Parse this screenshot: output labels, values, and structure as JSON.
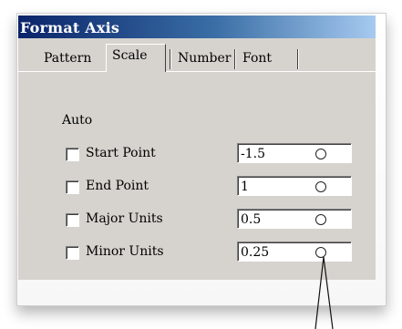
{
  "window": {
    "title": "Format Axis"
  },
  "tabs": [
    {
      "label": "Pattern",
      "active": false
    },
    {
      "label": "Scale",
      "active": true
    },
    {
      "label": "Number",
      "active": false
    },
    {
      "label": "Font",
      "active": false
    }
  ],
  "scale": {
    "auto_label": "Auto",
    "rows": [
      {
        "label": "Start Point",
        "checked": false,
        "value": "-1.5"
      },
      {
        "label": "End Point",
        "checked": false,
        "value": "1"
      },
      {
        "label": "Major Units",
        "checked": false,
        "value": "0.5"
      },
      {
        "label": "Minor Units",
        "checked": false,
        "value": "0.25"
      }
    ]
  },
  "icons": {
    "marker": "circle-marker-icon",
    "pointer": "callout-pointer"
  },
  "colors": {
    "title_start": "#0a246a",
    "title_end": "#a6caf0",
    "dialog_bg": "#d6d3ce"
  }
}
